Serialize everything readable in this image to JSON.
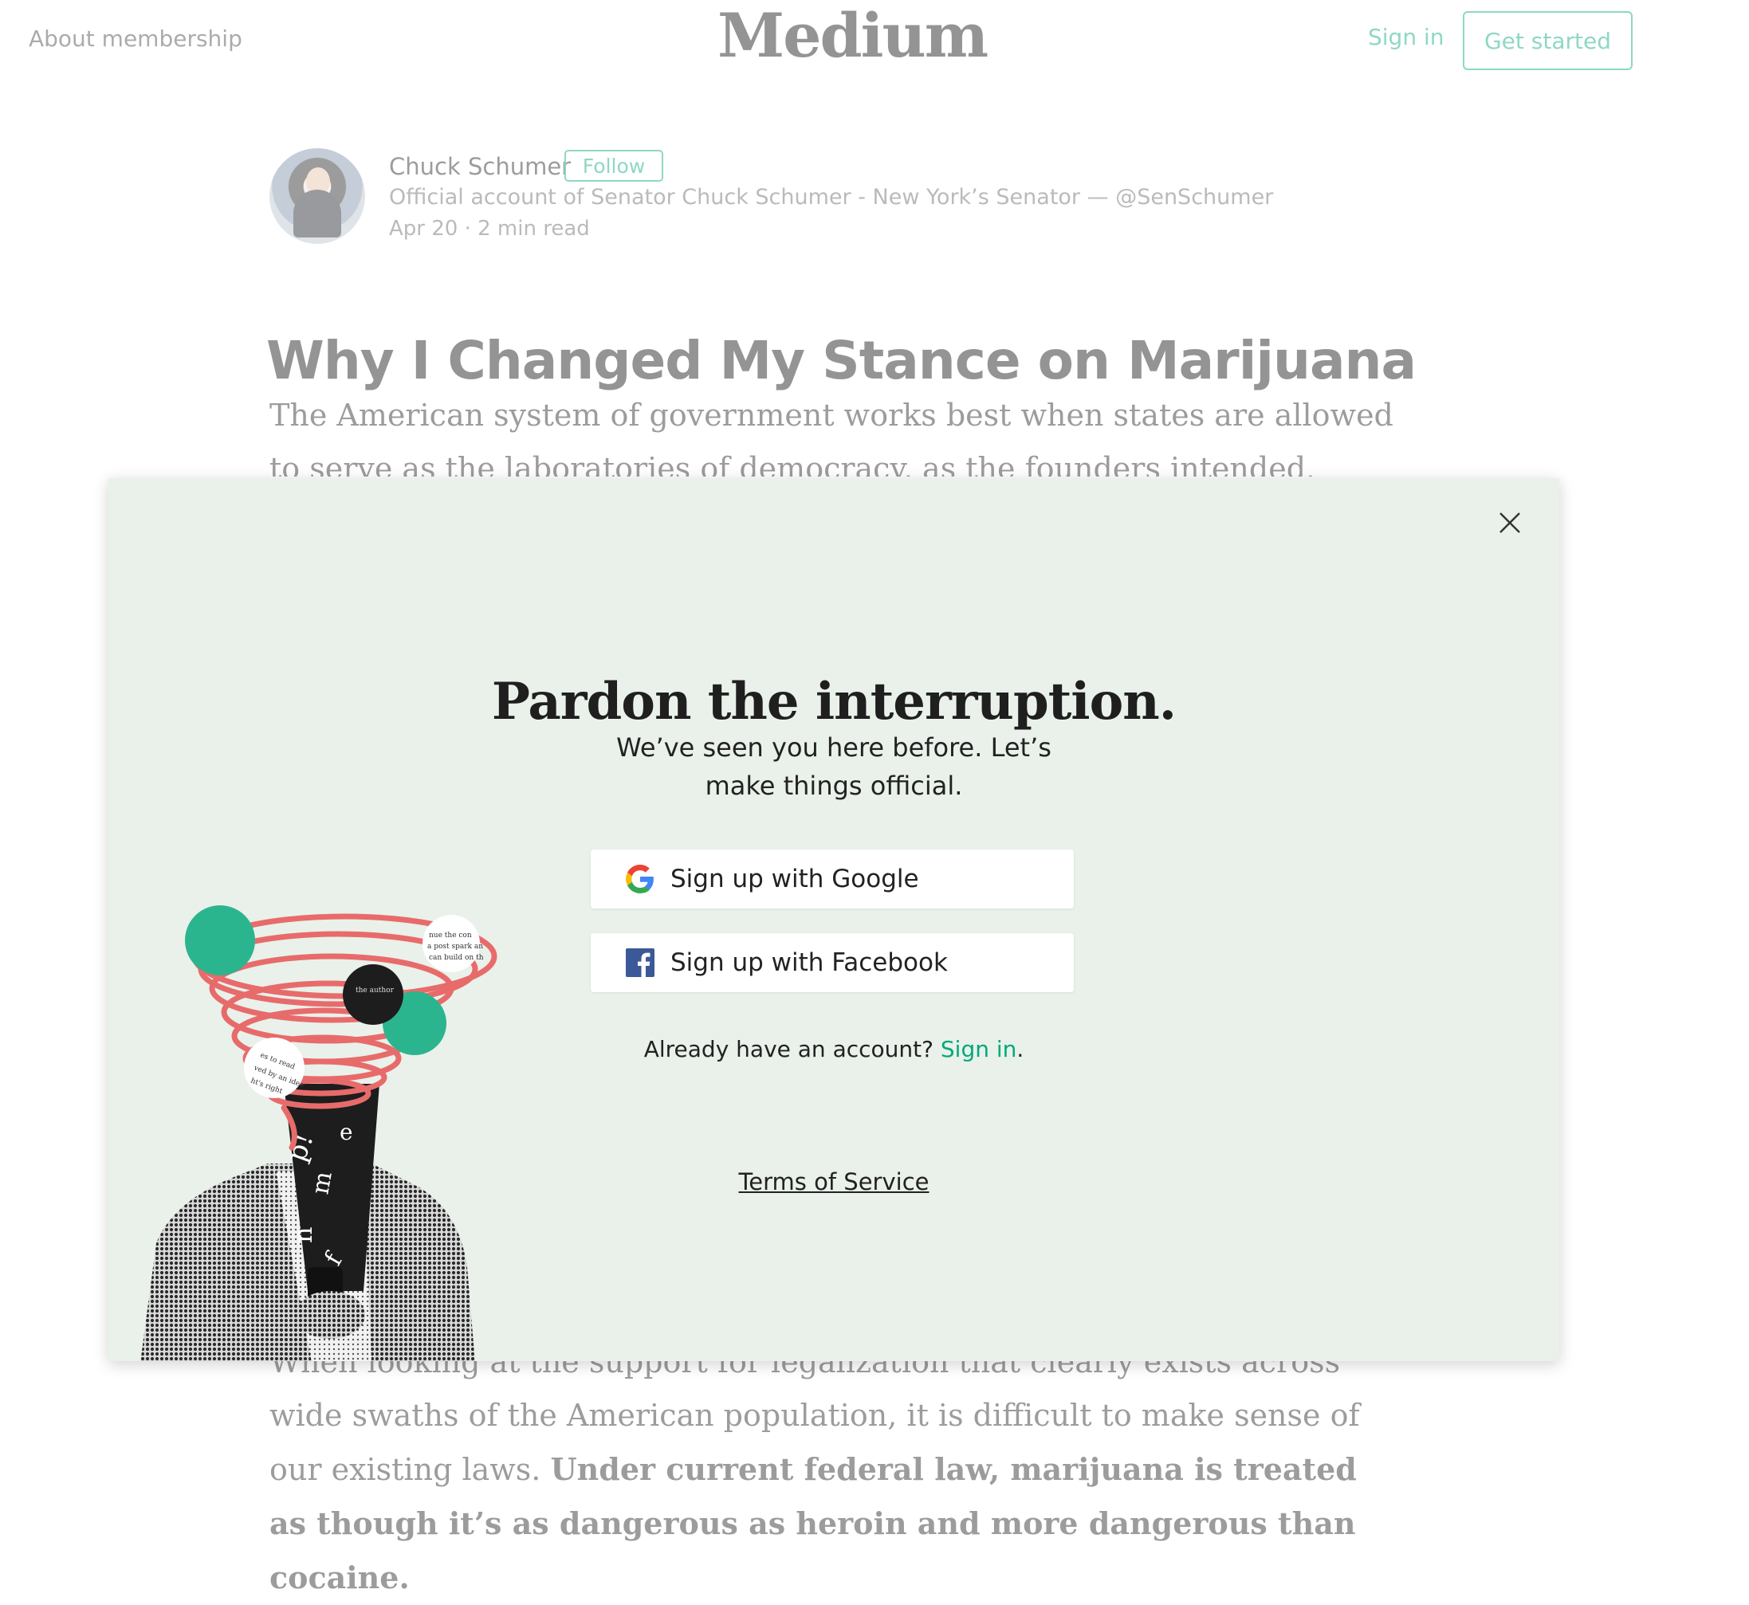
{
  "header": {
    "about_link": "About membership",
    "logo": "Medium",
    "sign_in": "Sign in",
    "get_started": "Get started"
  },
  "author": {
    "name": "Chuck Schumer",
    "follow": "Follow",
    "bio": "Official account of Senator Chuck Schumer - New York’s Senator — @SenSchumer",
    "meta": "Apr 20 · 2 min read"
  },
  "article": {
    "title": "Why I Changed My Stance on Marijuana",
    "intro": "The American system of government works best when states are allowed to serve as the laboratories of democracy, as the founders intended. What works",
    "para2_start": "When looking at the support for legalization that clearly exists across wide swaths of the American population, it is difficult to make sense of our existing laws.",
    "para2_bold": "Under current federal law, marijuana is treated as though it’s as dangerous as heroin and more dangerous than cocaine."
  },
  "modal": {
    "title": "Pardon the interruption.",
    "subtitle": "We’ve seen you here before. Let’s make things official.",
    "google_button": "Sign up with Google",
    "facebook_button": "Sign up with Facebook",
    "have_account": "Already have an account?",
    "sign_in_link": "Sign in",
    "period": ".",
    "terms": "Terms of Service"
  },
  "icons": {
    "close": "close-icon",
    "google": "google-icon",
    "facebook": "facebook-icon"
  },
  "colors": {
    "accent_green": "#03a87c",
    "modal_bg": "#e9f1ea",
    "illustration_red": "#e86b6b",
    "illustration_teal": "#2bb58e",
    "facebook_blue": "#3b5998"
  }
}
